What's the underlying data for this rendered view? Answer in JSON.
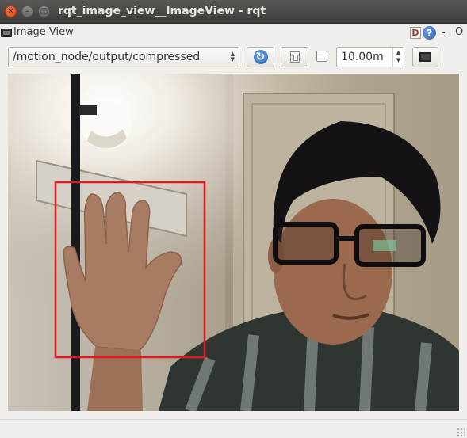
{
  "window": {
    "title": "rqt_image_view__ImageView - rqt",
    "close_glyph": "✕",
    "min_glyph": "–",
    "max_glyph": "□"
  },
  "plugin": {
    "title": "Image View",
    "d_label": "D",
    "help_label": "?",
    "minimize_label": "-",
    "close_label": "O"
  },
  "toolbar": {
    "topic": "/motion_node/output/compressed",
    "refresh_icon": "refresh-icon",
    "save_icon": "save-icon",
    "smooth_checked": false,
    "spin_value": "10.00m",
    "fit_icon": "fit-window-icon"
  },
  "image": {
    "overlay_color": "#e3181c",
    "description_icon": "camera-frame"
  }
}
